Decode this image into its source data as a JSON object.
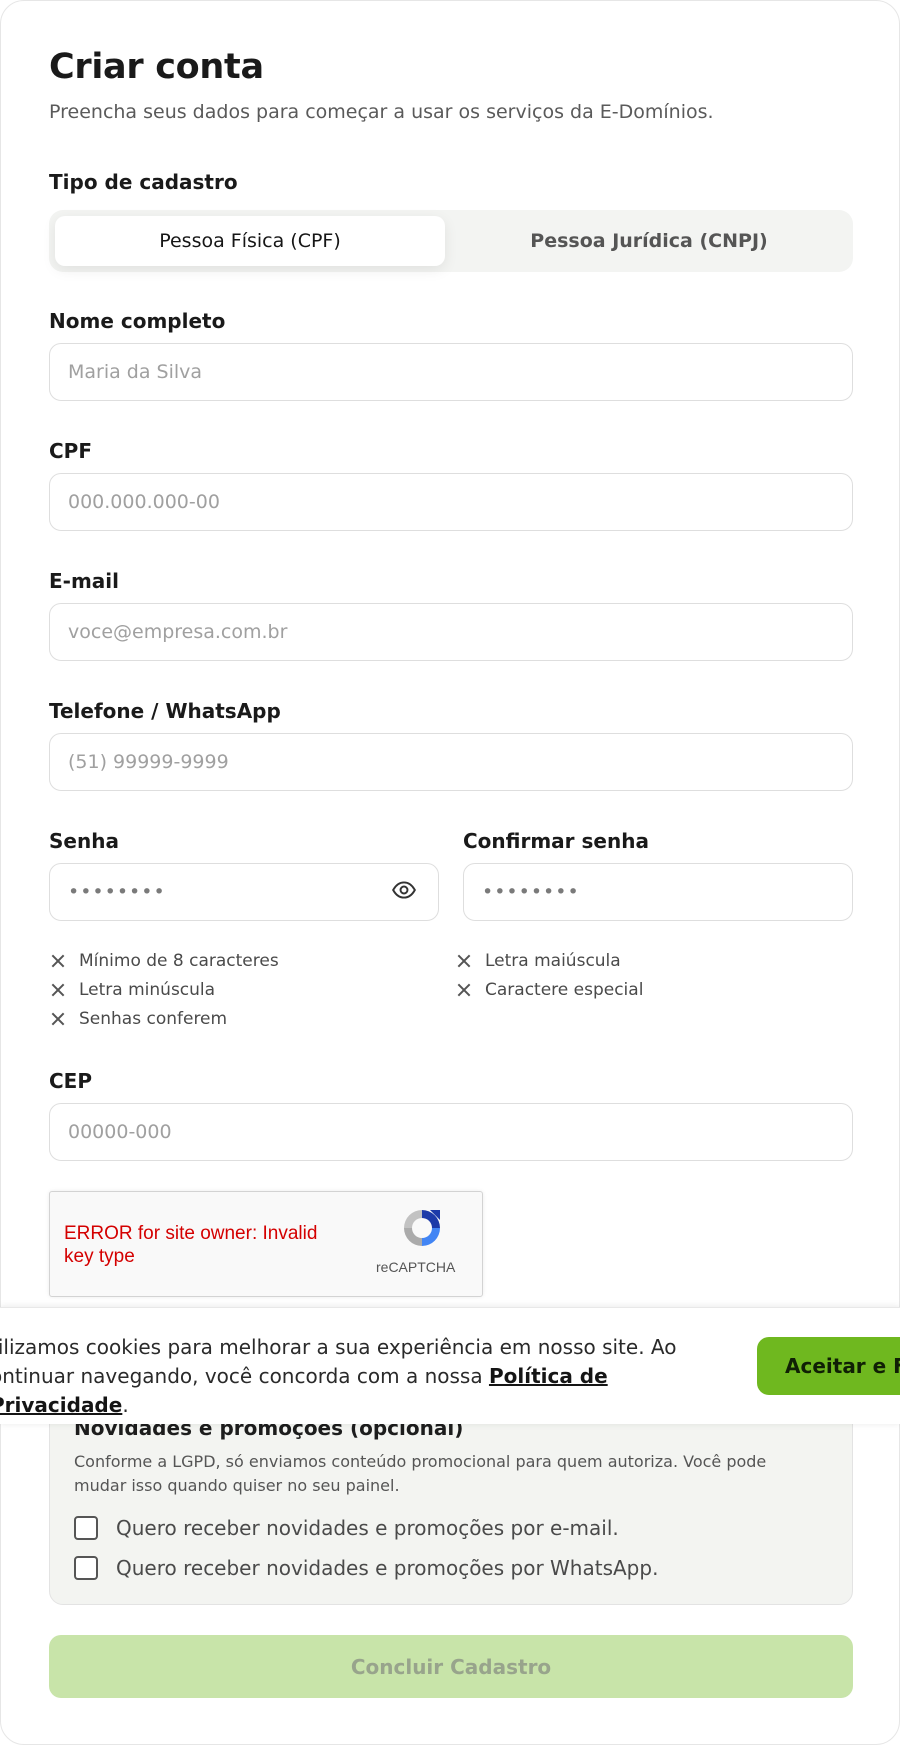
{
  "header": {
    "title": "Criar conta",
    "subtitle": "Preencha seus dados para começar a usar os serviços da E-Domínios."
  },
  "registration_type": {
    "label": "Tipo de cadastro",
    "options": [
      "Pessoa Física (CPF)",
      "Pessoa Jurídica (CNPJ)"
    ],
    "selected": "Pessoa Física (CPF)"
  },
  "fields": {
    "name": {
      "label": "Nome completo",
      "placeholder": "Maria da Silva"
    },
    "cpf": {
      "label": "CPF",
      "placeholder": "000.000.000-00"
    },
    "email": {
      "label": "E-mail",
      "placeholder": "voce@empresa.com.br"
    },
    "phone": {
      "label": "Telefone / WhatsApp",
      "placeholder": "(51) 99999-9999"
    },
    "password": {
      "label": "Senha",
      "placeholder": "••••••••"
    },
    "confirm_password": {
      "label": "Confirmar senha",
      "placeholder": "••••••••"
    },
    "cep": {
      "label": "CEP",
      "placeholder": "00000-000"
    }
  },
  "password_requirements": [
    "Mínimo de 8 caracteres",
    "Letra maiúscula",
    "Letra minúscula",
    "Caractere especial",
    "Senhas conferem"
  ],
  "recaptcha": {
    "error": "ERROR for site owner: Invalid key type",
    "brand": "reCAPTCHA"
  },
  "optin": {
    "title": "Novidades e promoções (opcional)",
    "description": "Conforme a LGPD, só enviamos conteúdo promocional para quem autoriza. Você pode mudar isso quando quiser no seu painel.",
    "email_label": "Quero receber novidades e promoções por e-mail.",
    "whatsapp_label": "Quero receber novidades e promoções por WhatsApp."
  },
  "submit_label": "Concluir Cadastro",
  "cookie_banner": {
    "line1": "tilizamos cookies para melhorar a sua experiência em nosso site. Ao",
    "line2": "ontinuar navegando, você concorda com a nossa ",
    "link": "Política de Privacidade",
    "trailing": ".",
    "button": "Aceitar e Fe"
  },
  "colors": {
    "accent": "#6fb81f",
    "submit_disabled": "#c8e4a9",
    "error": "#d40000"
  }
}
